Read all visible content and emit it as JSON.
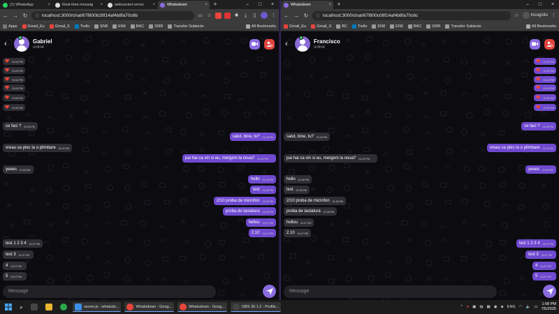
{
  "left": {
    "tabs": [
      {
        "title": "(1) WhatsApp",
        "color": "#25d366"
      },
      {
        "title": "Real-time messag",
        "color": "#dddddd"
      },
      {
        "title": "websocket-servic",
        "color": "#dddddd"
      },
      {
        "title": "Whatsdown",
        "color": "#8b6be0",
        "active": true
      }
    ],
    "url": "localhost:3000/chat/67f800b28f14af4b8fa70c6b",
    "bookmarks": [
      "Apps",
      "Gmail_Eu",
      "Gmail_S",
      "Trello",
      "EN8",
      "EN6",
      "BAC",
      "SIIIR",
      "Transfer Subiecte"
    ],
    "all_bookmarks": "All Bookmarks",
    "contact": {
      "name": "Gabriel",
      "status": "online"
    },
    "placeholder": "Message",
    "messages": [
      {
        "dir": "in",
        "text": "❤️",
        "time": "01:04 PM",
        "small": true
      },
      {
        "dir": "in",
        "text": "❤️",
        "time": "01:04 PM",
        "small": true
      },
      {
        "dir": "in",
        "text": "❤️",
        "time": "01:04 PM",
        "small": true
      },
      {
        "dir": "in",
        "text": "❤️",
        "time": "01:04 PM",
        "small": true
      },
      {
        "dir": "in",
        "text": "❤️",
        "time": "01:04 PM",
        "small": true
      },
      {
        "dir": "in",
        "text": "❤️",
        "time": "01:04 PM",
        "small": true
      },
      {
        "dir": "in",
        "text": "ce faci ?",
        "time": "01:04 PM"
      },
      {
        "dir": "out",
        "text": "salut, bine, tu?",
        "time": "01:04 PM"
      },
      {
        "dir": "in",
        "text": "vreau sa plec la o plimbare",
        "time": "01:04 PM"
      },
      {
        "dir": "out",
        "text": "pai hai ca vin si eu, mergem la noua?",
        "time": "01:04 PM"
      },
      {
        "dir": "in",
        "text": "yeees",
        "time": "01:05 PM"
      },
      {
        "dir": "out",
        "text": "hello",
        "time": "01:05 PM"
      },
      {
        "dir": "out",
        "text": "test",
        "time": "01:06 PM"
      },
      {
        "dir": "out",
        "text": "2/10 proba de microfon",
        "time": "01:06 PM"
      },
      {
        "dir": "out",
        "text": "proba de tastatura",
        "time": "01:06 PM"
      },
      {
        "dir": "out",
        "text": "hellou",
        "time": "01:07 PM"
      },
      {
        "dir": "out",
        "text": "2.10",
        "time": "01:07 PM"
      },
      {
        "dir": "in",
        "text": "test 1 2 3 4",
        "time": "01:07 PM"
      },
      {
        "dir": "in",
        "text": "test 3",
        "time": "01:07 PM"
      },
      {
        "dir": "in",
        "text": "4",
        "time": "01:07 PM"
      },
      {
        "dir": "in",
        "text": "5",
        "time": "01:07 PM"
      }
    ]
  },
  "right": {
    "tabs": [
      {
        "title": "Whatsdown",
        "color": "#8b6be0",
        "active": true
      }
    ],
    "url": "localhost:3000/chat/67f800c08f14af4b8fa70c6c",
    "incognito": "Incognito",
    "bookmarks": [
      "Gmail_Eu",
      "Gmail_S",
      "BC",
      "Trello",
      "EN8",
      "EN6",
      "BAC",
      "SIIIR",
      "Transfer Subiecte"
    ],
    "all_bookmarks": "All Bookmarks",
    "contact": {
      "name": "Francisco",
      "status": "online"
    },
    "placeholder": "Message",
    "messages": [
      {
        "dir": "out",
        "text": "❤️",
        "time": "01:04 PM",
        "small": true
      },
      {
        "dir": "out",
        "text": "❤️",
        "time": "01:04 PM",
        "small": true
      },
      {
        "dir": "out",
        "text": "❤️",
        "time": "01:04 PM",
        "small": true
      },
      {
        "dir": "out",
        "text": "❤️",
        "time": "01:04 PM",
        "small": true
      },
      {
        "dir": "out",
        "text": "❤️",
        "time": "01:04 PM",
        "small": true
      },
      {
        "dir": "out",
        "text": "❤️",
        "time": "01:04 PM",
        "small": true
      },
      {
        "dir": "out",
        "text": "ce faci ?",
        "time": "01:04 PM"
      },
      {
        "dir": "in",
        "text": "salut, bine, tu?",
        "time": "01:04 PM"
      },
      {
        "dir": "out",
        "text": "vreau sa plec la o plimbare",
        "time": "01:04 PM"
      },
      {
        "dir": "in",
        "text": "pai hai ca vin si eu, mergem la noua?",
        "time": "01:04 PM"
      },
      {
        "dir": "out",
        "text": "yeees",
        "time": "01:05 PM"
      },
      {
        "dir": "in",
        "text": "hello",
        "time": "01:05 PM"
      },
      {
        "dir": "in",
        "text": "test",
        "time": "01:06 PM"
      },
      {
        "dir": "in",
        "text": "2/10 proba de microfon",
        "time": "01:06 PM"
      },
      {
        "dir": "in",
        "text": "proba de tastatura",
        "time": "01:06 PM"
      },
      {
        "dir": "in",
        "text": "hellou",
        "time": "01:07 PM"
      },
      {
        "dir": "in",
        "text": "2.10",
        "time": "01:07 PM"
      },
      {
        "dir": "out",
        "text": "test 1 2 3 4",
        "time": "01:07 PM"
      },
      {
        "dir": "out",
        "text": "test 3",
        "time": "01:07 PM"
      },
      {
        "dir": "out",
        "text": "4",
        "time": "01:07 PM"
      },
      {
        "dir": "out",
        "text": "5",
        "time": "01:07 PM"
      }
    ]
  },
  "taskbar": {
    "items": [
      {
        "label": "server.js - whatsdo...",
        "color": "#3a8ee6"
      },
      {
        "label": "Whatsdown - Goog...",
        "color": "#e8453c"
      },
      {
        "label": "Whatsdown - Goog...",
        "color": "#e8453c"
      },
      {
        "label": "OBS 30.1.2 - Profile...",
        "color": "#444444"
      }
    ],
    "lang": "ENG",
    "time": "1:08 PM",
    "date": "7/5/2025"
  },
  "colors": {
    "accent": "#8b6be0",
    "outgoing": "#6f4ad0",
    "incoming": "#2e2e34",
    "danger": "#e0443e",
    "online": "#3ec46d"
  }
}
